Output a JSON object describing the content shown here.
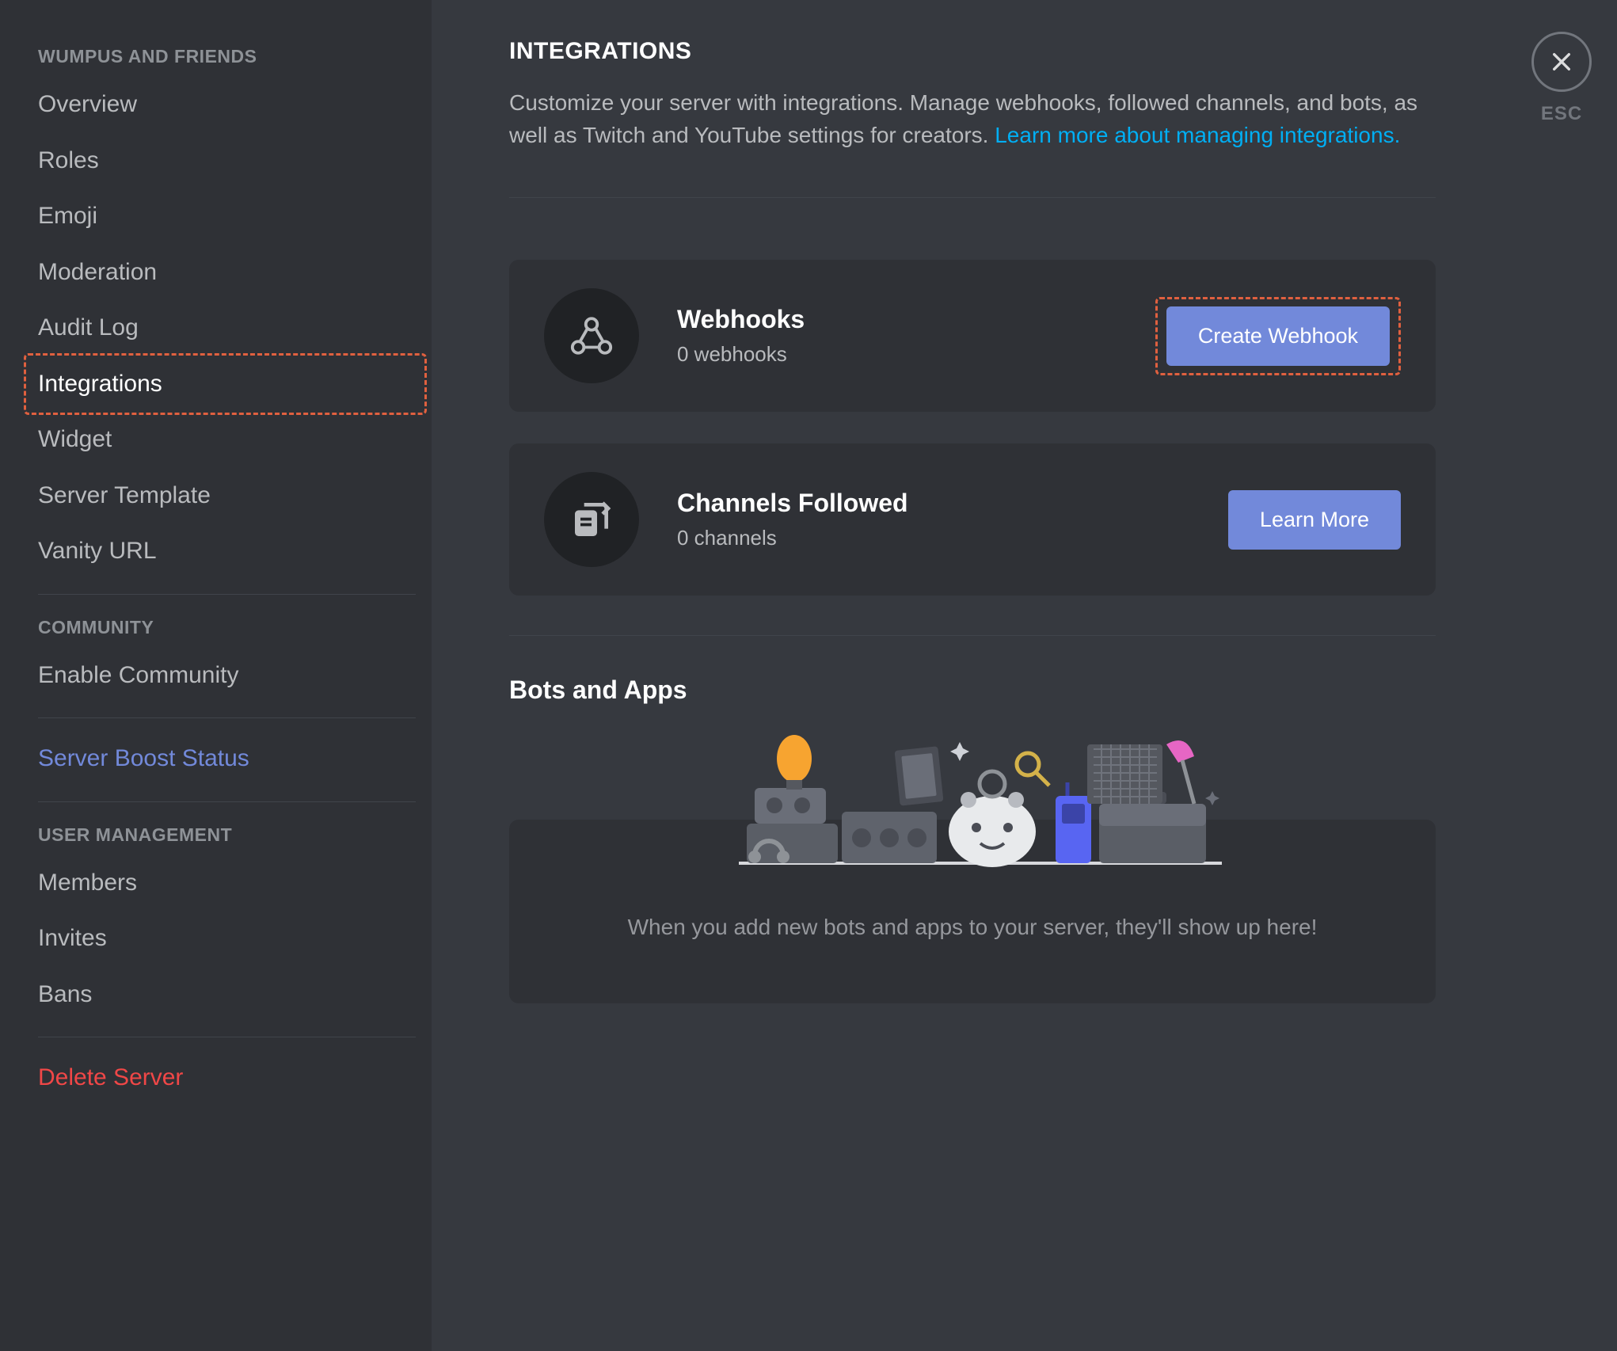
{
  "sidebar": {
    "sections": [
      {
        "header": "WUMPUS AND FRIENDS",
        "items": [
          {
            "key": "overview",
            "label": "Overview"
          },
          {
            "key": "roles",
            "label": "Roles"
          },
          {
            "key": "emoji",
            "label": "Emoji"
          },
          {
            "key": "moderation",
            "label": "Moderation"
          },
          {
            "key": "audit-log",
            "label": "Audit Log"
          },
          {
            "key": "integrations",
            "label": "Integrations",
            "selected": true
          },
          {
            "key": "widget",
            "label": "Widget"
          },
          {
            "key": "server-template",
            "label": "Server Template"
          },
          {
            "key": "vanity-url",
            "label": "Vanity URL"
          }
        ]
      },
      {
        "header": "COMMUNITY",
        "items": [
          {
            "key": "enable-community",
            "label": "Enable Community"
          }
        ]
      },
      {
        "items": [
          {
            "key": "boost",
            "label": "Server Boost Status",
            "style": "boost"
          }
        ]
      },
      {
        "header": "USER MANAGEMENT",
        "items": [
          {
            "key": "members",
            "label": "Members"
          },
          {
            "key": "invites",
            "label": "Invites"
          },
          {
            "key": "bans",
            "label": "Bans"
          }
        ]
      },
      {
        "items": [
          {
            "key": "delete-server",
            "label": "Delete Server",
            "style": "danger"
          }
        ]
      }
    ]
  },
  "main": {
    "title": "INTEGRATIONS",
    "description_prefix": "Customize your server with integrations. Manage webhooks, followed channels, and bots, as well as Twitch and YouTube settings for creators. ",
    "description_link": "Learn more about managing integrations.",
    "cards": {
      "webhooks": {
        "title": "Webhooks",
        "subtitle": "0 webhooks",
        "button": "Create Webhook"
      },
      "channels": {
        "title": "Channels Followed",
        "subtitle": "0 channels",
        "button": "Learn More"
      }
    },
    "bots_heading": "Bots and Apps",
    "placeholder": "When you add new bots and apps to your server, they'll show up here!"
  },
  "close": {
    "label": "ESC"
  }
}
